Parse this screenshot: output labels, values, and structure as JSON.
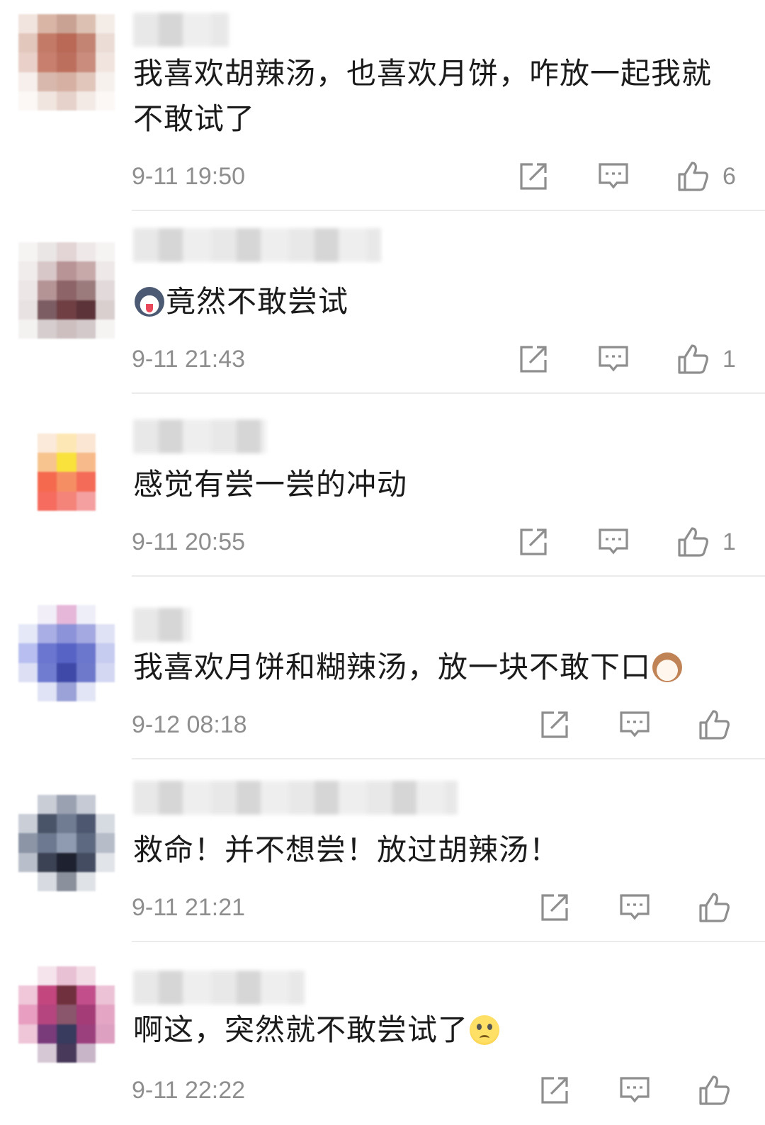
{
  "comments": [
    {
      "text": "我喜欢胡辣汤，也喜欢月饼，咋放一起我就不敢试了",
      "emoji_prefix": "",
      "emoji_suffix": "",
      "time": "9-11 19:50",
      "likes": "6",
      "avatar_colors": [
        "#f1e4de",
        "#d9b5a6",
        "#caa293",
        "#dcc1b2",
        "#f4ece7",
        "#e2c7bd",
        "#c37b68",
        "#b96956",
        "#c48474",
        "#ebdcd6",
        "#e9d0c8",
        "#c87f6d",
        "#bd6f5e",
        "#c98c7d",
        "#f1e4de",
        "#f6efeb",
        "#d8b8ac",
        "#d6b1a3",
        "#e1c6bb",
        "#f7f1ee",
        "#fbf8f6",
        "#f1e5e0",
        "#e6d2ca",
        "#f3eae6",
        "#fbf8f6"
      ]
    },
    {
      "text": "竟然不敢尝试",
      "emoji_prefix": "dog-emoji",
      "emoji_suffix": "",
      "time": "9-11 21:43",
      "likes": "1",
      "avatar_colors": [
        "#f6f3f3",
        "#ebe6e6",
        "#e3d4d5",
        "#efe8e8",
        "#f6f3f3",
        "#f0ecec",
        "#d8c7c8",
        "#b89496",
        "#c7a9aa",
        "#eee8e8",
        "#ece6e6",
        "#b59496",
        "#8d6467",
        "#9c7b7d",
        "#e2d9da",
        "#e9e2e2",
        "#7b5d63",
        "#6f3f44",
        "#5b3338",
        "#d9cfcf",
        "#f4f1f1",
        "#d6cdce",
        "#cdbfc0",
        "#d3c9ca",
        "#f6f3f3"
      ]
    },
    {
      "text": "感觉有尝一尝的冲动",
      "emoji_prefix": "",
      "emoji_suffix": "",
      "time": "9-11 20:55",
      "likes": "1",
      "avatar_colors": [
        "#ffffff",
        "#fbe9d9",
        "#fde8b5",
        "#fbe6d4",
        "#ffffff",
        "#ffffff",
        "#f7c48f",
        "#f9e23c",
        "#f7ba8a",
        "#ffffff",
        "#ffffff",
        "#f56a4f",
        "#f58f63",
        "#f46b58",
        "#ffffff",
        "#ffffff",
        "#f66c5e",
        "#f4837a",
        "#f4a0a0",
        "#ffffff",
        "#ffffff",
        "#ffffff",
        "#ffffff",
        "#ffffff",
        "#ffffff"
      ]
    },
    {
      "text": "我喜欢月饼和糊辣汤，放一块不敢下口",
      "emoji_prefix": "",
      "emoji_suffix": "cat-emoji",
      "time": "9-12 08:18",
      "likes": "",
      "avatar_colors": [
        "#ffffff",
        "#f1eef8",
        "#e6b7d8",
        "#eeeef9",
        "#ffffff",
        "#e5e8f7",
        "#a9aee4",
        "#8d93d8",
        "#a4a9e1",
        "#dfe2f5",
        "#b8bff0",
        "#6a76cf",
        "#5763c5",
        "#6b76cd",
        "#c6cbf0",
        "#dde0f5",
        "#6f7cd0",
        "#3f4aa8",
        "#6e79cb",
        "#d3d7f2",
        "#ffffff",
        "#e0e3f5",
        "#9aa2d8",
        "#e2e5f5",
        "#ffffff"
      ]
    },
    {
      "text": "救命！并不想尝！放过胡辣汤！",
      "emoji_prefix": "",
      "emoji_suffix": "",
      "time": "9-11 21:21",
      "likes": "",
      "avatar_colors": [
        "#ffffff",
        "#c9cdd6",
        "#9aa2b2",
        "#c5cad4",
        "#ffffff",
        "#c9ced7",
        "#4a5468",
        "#707c91",
        "#4d5870",
        "#d6dae1",
        "#8b95a6",
        "#6d7990",
        "#8f9bb0",
        "#5d6980",
        "#b6bcc8",
        "#b9bfca",
        "#3b4253",
        "#1e2230",
        "#434c60",
        "#e1e4e9",
        "#ffffff",
        "#d7dbe1",
        "#8a909c",
        "#dfe2e7",
        "#ffffff"
      ]
    },
    {
      "text": "啊这，突然就不敢尝试了",
      "emoji_prefix": "",
      "emoji_suffix": "sad-emoji",
      "time": "9-11 22:22",
      "likes": "",
      "avatar_colors": [
        "#ffffff",
        "#f5e4ec",
        "#e9c1d4",
        "#f3dbe6",
        "#ffffff",
        "#efc7d9",
        "#c3467f",
        "#71303e",
        "#c24f8b",
        "#ecc3d6",
        "#e89ec0",
        "#b5457e",
        "#89566b",
        "#a43c78",
        "#e4a5c4",
        "#eec6d8",
        "#7a3b7b",
        "#383a5e",
        "#9c3f7d",
        "#dda0c1",
        "#ffffff",
        "#d7c8d6",
        "#48385a",
        "#c9b5c8",
        "#ffffff"
      ]
    }
  ],
  "icons": {
    "share": "share-icon",
    "reply": "comment-icon",
    "like": "thumbs-up-icon"
  },
  "colors": {
    "meta_text": "#8e8e8e",
    "divider": "#ebebeb"
  }
}
